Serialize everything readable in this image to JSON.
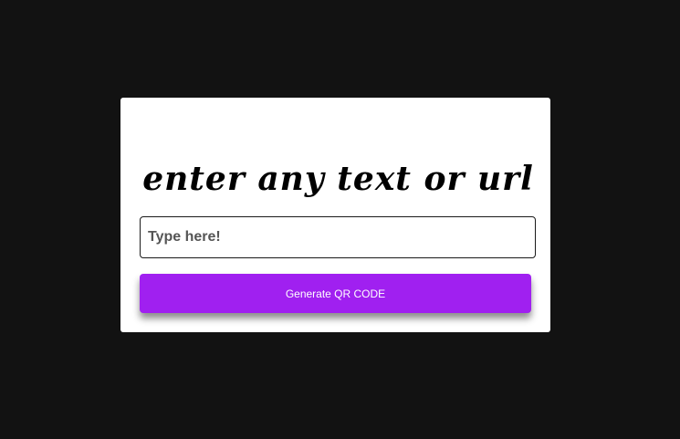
{
  "card": {
    "title": "enter any text or url",
    "input": {
      "value": "",
      "placeholder": "Type here!"
    },
    "button_label": "Generate QR CODE"
  },
  "colors": {
    "background": "#121212",
    "card": "#ffffff",
    "accent": "#a020f0"
  }
}
